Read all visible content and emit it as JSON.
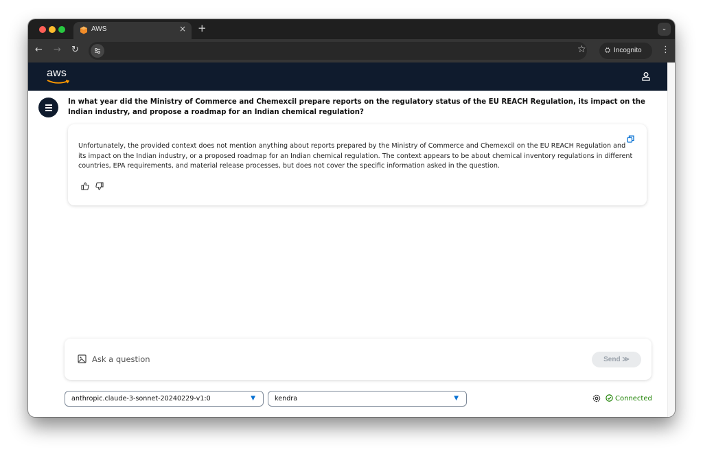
{
  "browser": {
    "tab_title": "AWS",
    "tab_close": "×",
    "new_tab": "+",
    "incognito_label": "Incognito",
    "icons": [
      "back-arrow-icon",
      "forward-arrow-icon",
      "reload-icon",
      "site-settings-icon",
      "bookmark-star-icon",
      "incognito-icon",
      "kebab-menu-icon",
      "tab-search-icon"
    ]
  },
  "header": {
    "logo_text": "aws",
    "brand_color": "#0f1b2d",
    "accent_color": "#ff9900"
  },
  "chat": {
    "question": "In what year did the Ministry of Commerce and Chemexcil prepare reports on the regulatory status of the EU REACH Regulation, its impact on the Indian industry, and propose a roadmap for an Indian chemical regulation?",
    "answer": "Unfortunately, the provided context does not mention anything about reports prepared by the Ministry of Commerce and Chemexcil on the EU REACH Regulation and its impact on the Indian industry, or a proposed roadmap for an Indian chemical regulation. The context appears to be about chemical inventory regulations in different countries, EPA requirements, and material release processes, but does not cover the specific information asked in the question."
  },
  "input": {
    "placeholder": "Ask a question",
    "value": "",
    "send_label": "Send ≫"
  },
  "selectors": {
    "model": "anthropic.claude-3-sonnet-20240229-v1:0",
    "knowledge_base": "kendra"
  },
  "status": {
    "label": "Connected",
    "color": "#1d8102"
  }
}
